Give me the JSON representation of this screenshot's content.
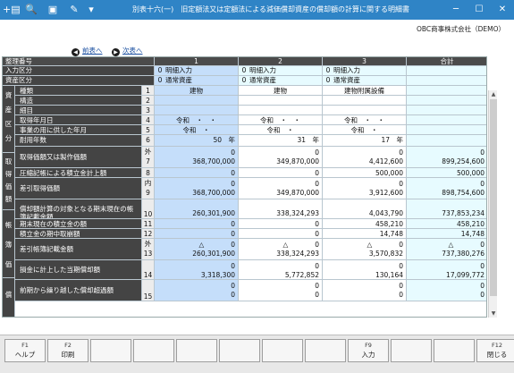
{
  "window": {
    "title": "別表十六(一)　旧定額法又は定額法による減価償却資産の償却額の計算に関する明細書",
    "company": "OBC商事株式会社（DEMO）"
  },
  "nav": {
    "prev": "前表へ",
    "next": "次表へ"
  },
  "header": {
    "row_label": "整理番号",
    "columns": [
      "1",
      "2",
      "3",
      "合計"
    ],
    "input_label": "入力区分",
    "input": [
      {
        "code": "0",
        "text": "明細入力"
      },
      {
        "code": "0",
        "text": "明細入力"
      },
      {
        "code": "0",
        "text": "明細入力"
      }
    ],
    "asset_label": "資産区分",
    "asset": [
      {
        "code": "0",
        "text": "通常資産"
      },
      {
        "code": "0",
        "text": "通常資産"
      },
      {
        "code": "0",
        "text": "通常資産"
      }
    ]
  },
  "sections": [
    {
      "label": "資\n産\n区\n分"
    },
    {
      "label": "取\n得\n価\n額"
    },
    {
      "label": "帳\n簿\n価"
    },
    {
      "label": "償"
    }
  ],
  "rows": [
    {
      "label": "種類",
      "no": "1",
      "vals": [
        "建物",
        "建物",
        "建物附属設備",
        ""
      ]
    },
    {
      "label": "構造",
      "no": "2",
      "vals": [
        "",
        "",
        "",
        ""
      ]
    },
    {
      "label": "細目",
      "no": "3",
      "vals": [
        "",
        "",
        "",
        ""
      ]
    },
    {
      "label": "取得年月日",
      "no": "4",
      "vals": [
        "令和　・　・",
        "令和　・　・",
        "令和　・　・",
        ""
      ]
    },
    {
      "label": "事業の用に供した年月",
      "no": "5",
      "vals": [
        "令和　・",
        "令和　・",
        "令和　・",
        ""
      ]
    },
    {
      "label": "耐用年数",
      "no": "6",
      "vals": [
        "50　年",
        "31　年",
        "17　年",
        ""
      ]
    },
    {
      "label": "取得価額又は製作価額",
      "no_top": "外",
      "no": "7",
      "top": [
        "0",
        "0",
        "0",
        "0"
      ],
      "vals": [
        "368,700,000",
        "349,870,000",
        "4,412,600",
        "899,254,600"
      ]
    },
    {
      "label": "圧縮記帳による積立金計上額",
      "no": "8",
      "vals": [
        "0",
        "0",
        "500,000",
        "500,000"
      ]
    },
    {
      "label": "差引取得価額",
      "no_top": "内",
      "no": "9",
      "top": [
        "0",
        "0",
        "0",
        "0"
      ],
      "vals": [
        "368,700,000",
        "349,870,000",
        "3,912,600",
        "898,754,600"
      ]
    },
    {
      "label": "償却額計算の対象となる期末現在の帳簿記載金額",
      "no": "10",
      "vals": [
        "260,301,900",
        "338,324,293",
        "4,043,790",
        "737,853,234"
      ]
    },
    {
      "label": "期末現在の積立金の額",
      "no": "11",
      "vals": [
        "0",
        "0",
        "458,210",
        "458,210"
      ]
    },
    {
      "label": "積立金の期中取崩額",
      "no": "12",
      "vals": [
        "0",
        "0",
        "14,748",
        "14,748"
      ]
    },
    {
      "label": "差引帳簿記載金額",
      "no_top": "外",
      "no": "13",
      "top": [
        "△　　　　0",
        "△　　　　0",
        "△　　　　0",
        "△　　　　0"
      ],
      "vals": [
        "260,301,900",
        "338,324,293",
        "3,570,832",
        "737,380,276"
      ]
    },
    {
      "label": "損金に計上した当期償却額",
      "no": "14",
      "top": [
        "0",
        "0",
        "0",
        "0"
      ],
      "vals": [
        "3,318,300",
        "5,772,852",
        "130,164",
        "17,099,772"
      ]
    },
    {
      "label": "前期から繰り越した償却超過額",
      "no": "15",
      "top": [
        "0",
        "0",
        "0",
        "0"
      ],
      "vals": [
        "0",
        "0",
        "0",
        "0"
      ]
    }
  ],
  "fkeys": [
    {
      "key": "F1",
      "label": "ヘルプ"
    },
    {
      "key": "F2",
      "label": "印刷"
    },
    {
      "key": "",
      "label": ""
    },
    {
      "key": "",
      "label": ""
    },
    {
      "key": "",
      "label": ""
    },
    {
      "key": "",
      "label": ""
    },
    {
      "key": "",
      "label": ""
    },
    {
      "key": "",
      "label": ""
    },
    {
      "key": "F9",
      "label": "入力"
    },
    {
      "key": "",
      "label": ""
    },
    {
      "key": "",
      "label": ""
    },
    {
      "key": "F12",
      "label": "閉じる"
    }
  ],
  "toolbar_icons": [
    "add-document-icon",
    "zoom-icon",
    "print-icon",
    "pin-icon",
    "dropdown-icon"
  ],
  "colors": {
    "titlebar": "#2f84c6",
    "selected_column": "#c5defa",
    "total_column": "#e7fbff"
  }
}
